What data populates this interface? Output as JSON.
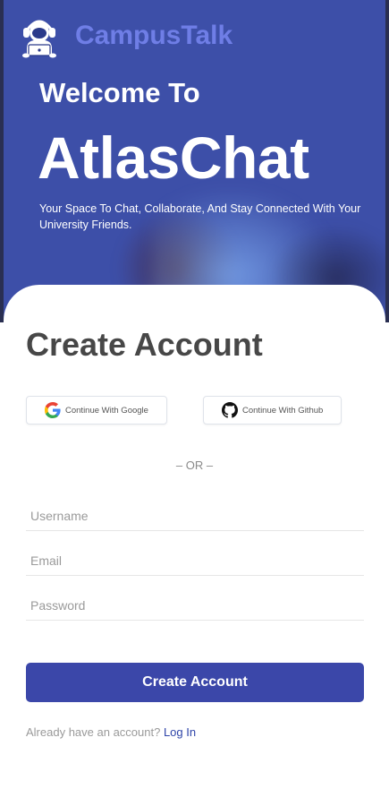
{
  "brand": {
    "name": "CampusTalk",
    "logo_icon": "astronaut-mascot-icon"
  },
  "hero": {
    "welcome": "Welcome To",
    "app_name": "AtlasChat",
    "tagline": "Your Space To Chat, Collaborate, And Stay Connected With Your University Friends."
  },
  "form": {
    "title": "Create Account",
    "google_label": "Continue With Google",
    "google_icon": "google-icon",
    "github_label": "Continue With Github",
    "github_icon": "github-icon",
    "or_text": "– OR –",
    "username": {
      "value": "",
      "placeholder": "Username"
    },
    "email": {
      "value": "",
      "placeholder": "Email"
    },
    "password": {
      "value": "",
      "placeholder": "Password"
    },
    "submit_label": "Create Account",
    "footer_text": "Already have an account?",
    "login_link": "Log In"
  },
  "colors": {
    "hero_bg": "#3d4fa8",
    "brand_text": "#6f7ee6",
    "primary_button": "#3b47a9",
    "link": "#2e44a8",
    "title_text": "#474747"
  }
}
